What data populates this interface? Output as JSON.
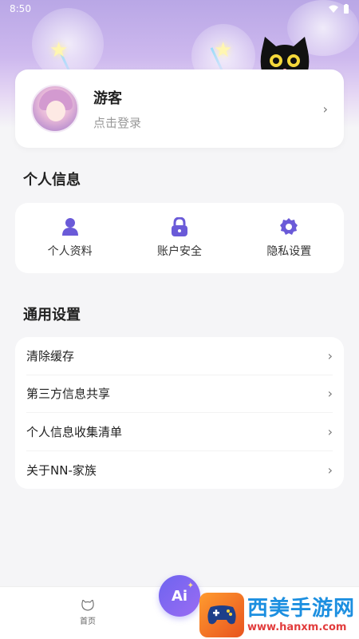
{
  "status_bar": {
    "time": "8:50"
  },
  "profile": {
    "name": "游客",
    "subtitle": "点击登录"
  },
  "personal_info": {
    "title": "个人信息",
    "items": [
      {
        "label": "个人资料",
        "icon": "user-icon"
      },
      {
        "label": "账户安全",
        "icon": "lock-icon"
      },
      {
        "label": "隐私设置",
        "icon": "gear-icon"
      }
    ]
  },
  "general_settings": {
    "title": "通用设置",
    "items": [
      {
        "label": "清除缓存"
      },
      {
        "label": "第三方信息共享"
      },
      {
        "label": "个人信息收集清单"
      },
      {
        "label": "关于NN-家族"
      }
    ]
  },
  "bottom_nav": {
    "home_label": "首页",
    "ai_label": "Ai"
  },
  "watermark": {
    "title": "西美手游网",
    "url": "www.hanxm.com"
  },
  "colors": {
    "accent": "#6e64f0",
    "icon": "#6a5ad8",
    "background": "#f5f5f7"
  }
}
